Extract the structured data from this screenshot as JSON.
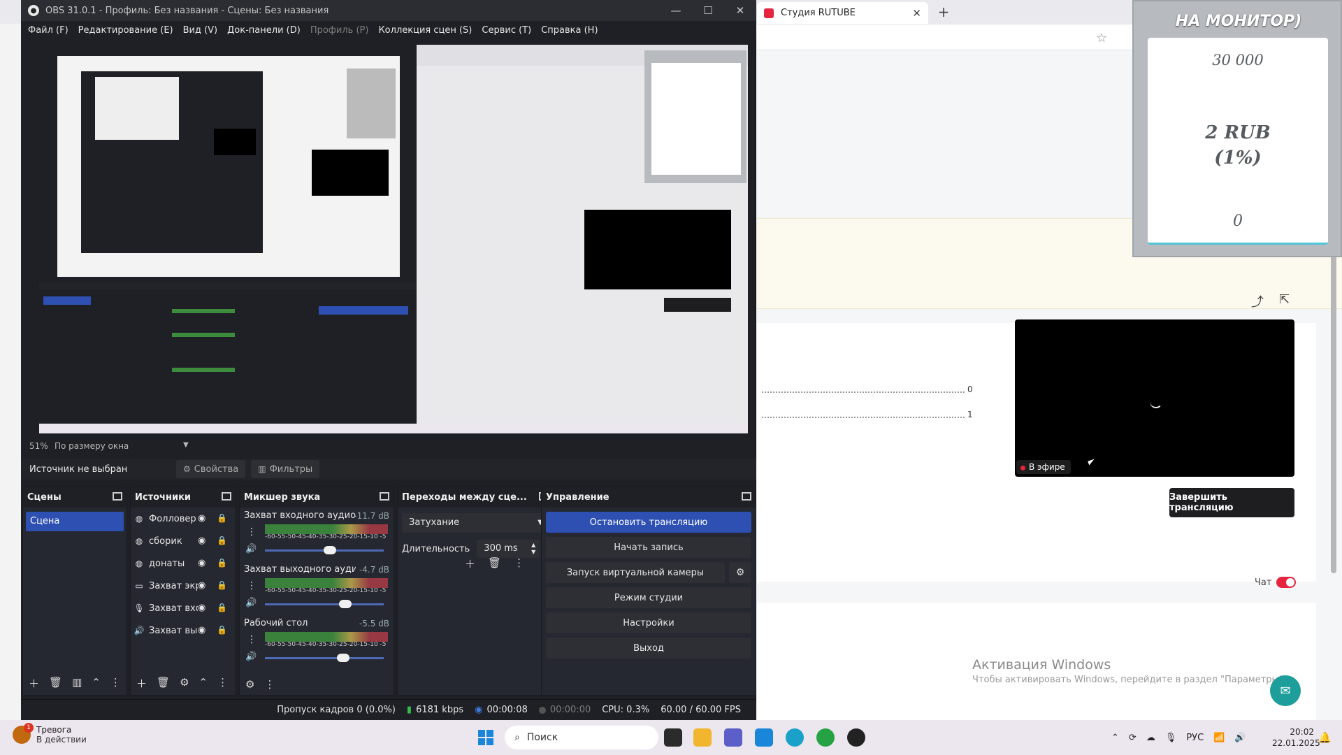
{
  "obs": {
    "title": "OBS 31.0.1 - Профиль: Без названия - Сцены: Без названия",
    "menu": [
      {
        "label": "Файл (F)",
        "disabled": false
      },
      {
        "label": "Редактирование (E)",
        "disabled": false
      },
      {
        "label": "Вид (V)",
        "disabled": false
      },
      {
        "label": "Док-панели (D)",
        "disabled": false
      },
      {
        "label": "Профиль (P)",
        "disabled": true
      },
      {
        "label": "Коллекция сцен (S)",
        "disabled": false
      },
      {
        "label": "Сервис (T)",
        "disabled": false
      },
      {
        "label": "Справка (H)",
        "disabled": false
      }
    ],
    "zoom": {
      "percent": "51%",
      "mode": "По размеру окна"
    },
    "source_bar": {
      "none": "Источник не выбран",
      "properties": "Свойства",
      "filters": "Фильтры"
    },
    "docks": {
      "scenes": {
        "title": "Сцены",
        "items": [
          "Сцена"
        ]
      },
      "sources": {
        "title": "Источники",
        "items": [
          {
            "label": "Фолловер",
            "icon": "globe-icon"
          },
          {
            "label": "сборик",
            "icon": "globe-icon"
          },
          {
            "label": "донаты",
            "icon": "globe-icon"
          },
          {
            "label": "Захват экр",
            "icon": "monitor-icon"
          },
          {
            "label": "Захват вхс",
            "icon": "mic-icon"
          },
          {
            "label": "Захват вы",
            "icon": "speaker-icon"
          }
        ]
      },
      "mixer": {
        "title": "Микшер звука",
        "scale": "-60-55-50-45-40-35-30-25-20-15-10 -5 0",
        "channels": [
          {
            "name": "Захват входного аудиопо",
            "db": "-11.7 dB",
            "volume": 0.55
          },
          {
            "name": "Захват выходного аудиопо",
            "db": "-4.7 dB",
            "volume": 0.7
          },
          {
            "name": "Рабочий стол",
            "db": "-5.5 dB",
            "volume": 0.68
          }
        ]
      },
      "transitions": {
        "title": "Переходы между сце...",
        "selected": "Затухание",
        "duration_label": "Длительность",
        "duration": "300 ms"
      },
      "controls": {
        "title": "Управление",
        "stop_stream": "Остановить трансляцию",
        "start_record": "Начать запись",
        "virtual_cam": "Запуск виртуальной камеры",
        "studio_mode": "Режим студии",
        "settings": "Настройки",
        "exit": "Выход"
      }
    },
    "status": {
      "dropped": "Пропуск кадров 0 (0.0%)",
      "bitrate": "6181 kbps",
      "stream_time": "00:00:08",
      "record_time": "00:00:00",
      "cpu": "CPU: 0.3%",
      "fps": "60.00 / 60.00 FPS"
    }
  },
  "browser": {
    "tab_title": "Студия RUTUBE",
    "monitor": {
      "title": "НА МОНИТОР)",
      "value1": "30 000",
      "value2_line1": "2 RUB",
      "value2_line2": "(1%)",
      "value3": "0"
    },
    "dotline_values": [
      "0",
      "1"
    ],
    "live_badge": "В эфире",
    "end_stream": "Завершить трансляцию",
    "chat_label": "Чат",
    "win_activation_title": "Активация Windows",
    "win_activation_sub": "Чтобы активировать Windows, перейдите в раздел \"Параметры\""
  },
  "taskbar": {
    "alert_title": "Тревога",
    "alert_sub": "В действии",
    "search_placeholder": "Поиск",
    "lang": "РУС",
    "time": "20:02",
    "date": "22.01.2025"
  }
}
